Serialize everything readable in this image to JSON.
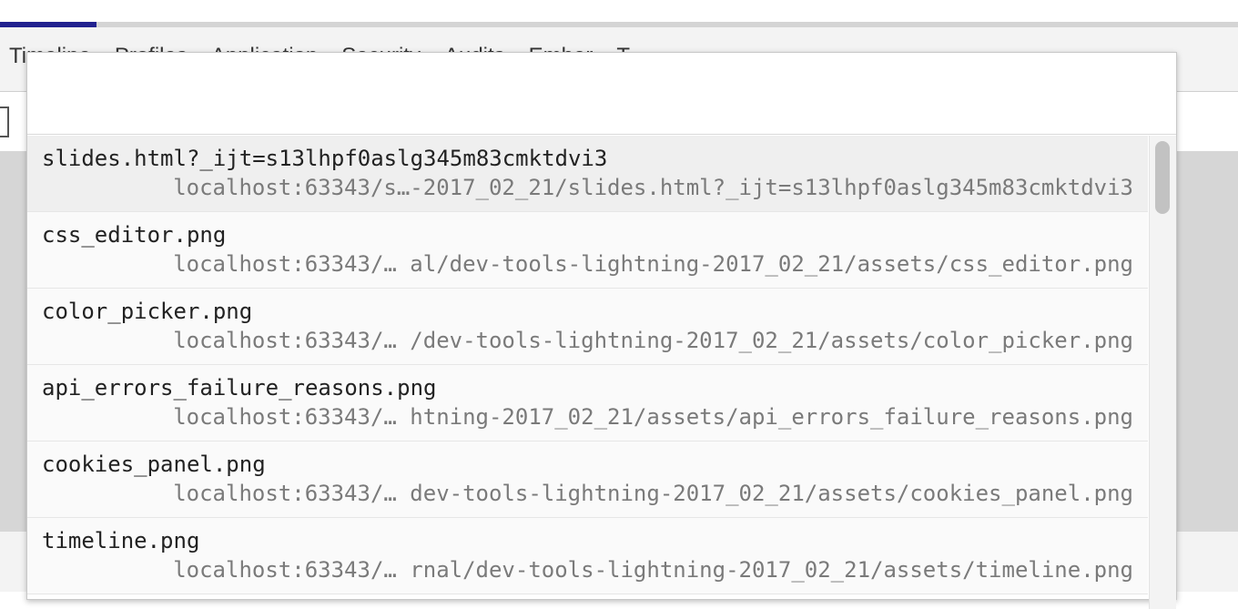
{
  "loading_progress": 0.078,
  "devtools": {
    "tabs": [
      "Timeline",
      "Profiles",
      "Application",
      "Security",
      "Audits",
      "Ember",
      "T"
    ]
  },
  "quick_open": {
    "query": "",
    "results": [
      {
        "title": "slides.html?_ijt=s13lhpf0aslg345m83cmktdvi3",
        "path": "localhost:63343/s…-2017_02_21/slides.html?_ijt=s13lhpf0aslg345m83cmktdvi3",
        "selected": true
      },
      {
        "title": "css_editor.png",
        "path": "localhost:63343/… al/dev-tools-lightning-2017_02_21/assets/css_editor.png"
      },
      {
        "title": "color_picker.png",
        "path": "localhost:63343/… /dev-tools-lightning-2017_02_21/assets/color_picker.png"
      },
      {
        "title": "api_errors_failure_reasons.png",
        "path": "localhost:63343/… htning-2017_02_21/assets/api_errors_failure_reasons.png"
      },
      {
        "title": "cookies_panel.png",
        "path": "localhost:63343/… dev-tools-lightning-2017_02_21/assets/cookies_panel.png"
      },
      {
        "title": "timeline.png",
        "path": "localhost:63343/… rnal/dev-tools-lightning-2017_02_21/assets/timeline.png"
      }
    ]
  }
}
